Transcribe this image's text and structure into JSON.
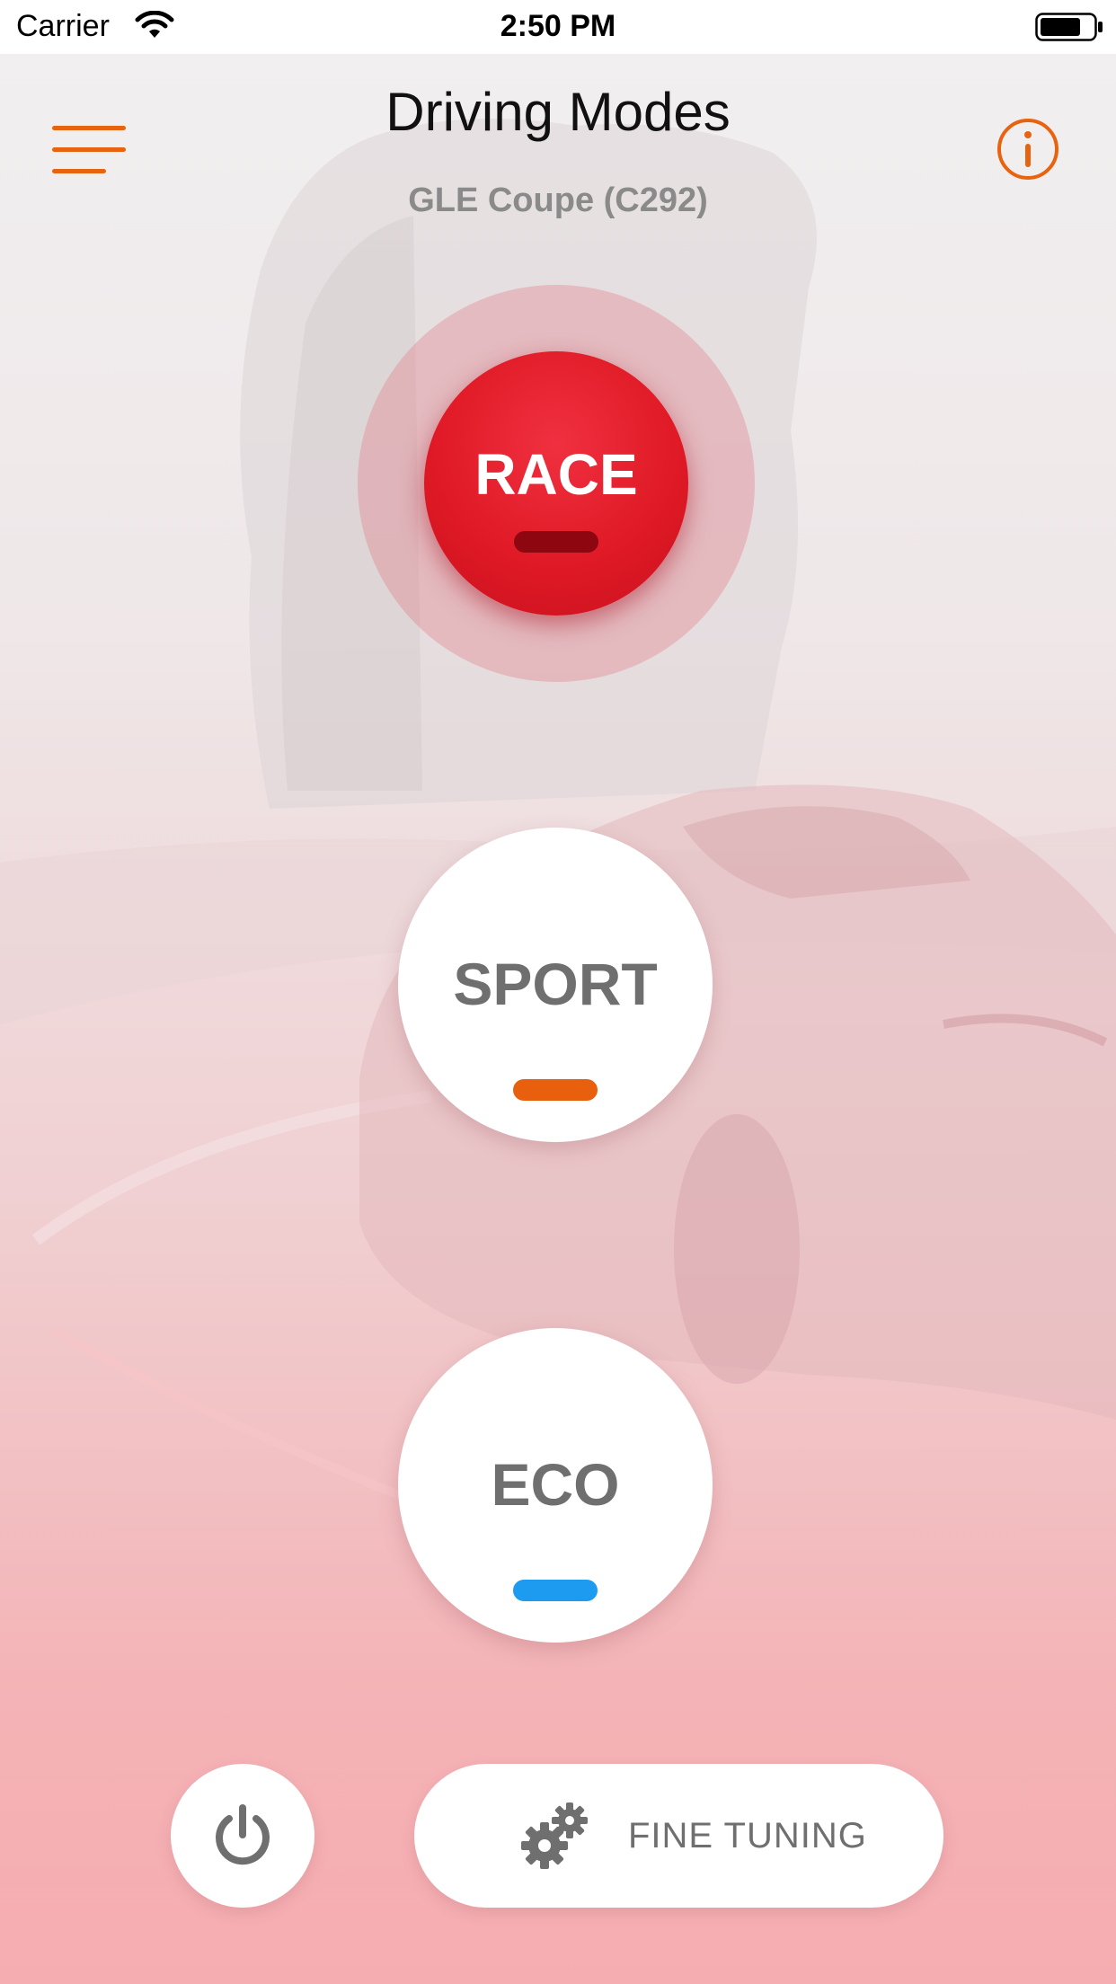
{
  "status_bar": {
    "carrier": "Carrier",
    "time": "2:50 PM",
    "wifi_icon": "wifi-icon",
    "battery_icon": "battery-icon"
  },
  "header": {
    "title": "Driving Modes",
    "subtitle": "GLE Coupe (C292)",
    "menu_icon": "hamburger-menu-icon",
    "info_icon": "info-icon"
  },
  "modes": {
    "race": {
      "label": "RACE",
      "selected": true,
      "indicator_color": "#8e0710"
    },
    "sport": {
      "label": "SPORT",
      "selected": false,
      "indicator_color": "#e8600e"
    },
    "eco": {
      "label": "ECO",
      "selected": false,
      "indicator_color": "#1d9bf0"
    }
  },
  "footer": {
    "power_icon": "power-icon",
    "fine_tuning_label": "FINE TUNING",
    "gear_icon": "gears-icon"
  },
  "colors": {
    "accent": "#e8630f",
    "race_red": "#e01a26",
    "eco_blue": "#1d9bf0"
  }
}
